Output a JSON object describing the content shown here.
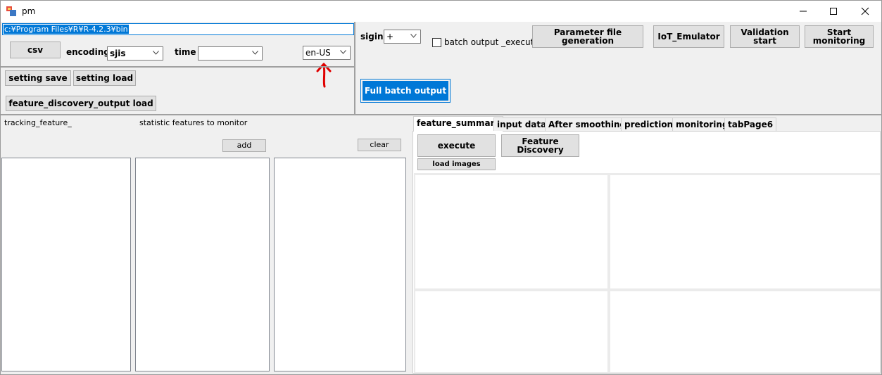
{
  "window": {
    "title": "pm"
  },
  "path_input": {
    "value": "c:¥Program Files¥R¥R-4.2.3¥bin"
  },
  "toolbar": {
    "csv_label": "csv",
    "encoding_label": "encoding",
    "encoding_value": "sjis",
    "time_label": "time",
    "time_value": "",
    "locale_value": "en-US",
    "setting_save_label": "setting save",
    "setting_load_label": "setting load",
    "feature_discovery_output_load_label": "feature_discovery_output load"
  },
  "right_top": {
    "sigin_label": "sigin",
    "sigin_value": "+",
    "batch_output_execute_label": "batch output _execute",
    "parameter_file_generation_label": "Parameter file generation",
    "iot_emulator_label": "IoT_Emulator",
    "validation_start_label": "Validation start",
    "start_monitoring_label": "Start monitoring",
    "full_batch_output_label": "Full batch output"
  },
  "left_panel": {
    "tracking_feature_label": "tracking_feature_",
    "statistic_features_label": "statistic features to monitor",
    "add_label": "add",
    "clear_label": "clear"
  },
  "tabs": [
    {
      "label": "feature_summary",
      "active": true
    },
    {
      "label": "input data"
    },
    {
      "label": "After smoothing"
    },
    {
      "label": "prediction"
    },
    {
      "label": "monitoring"
    },
    {
      "label": "tabPage6"
    }
  ],
  "feature_summary": {
    "execute_label": "execute",
    "feature_discovery_label": "Feature Discovery",
    "load_images_label": "load images"
  },
  "colors": {
    "accent": "#0078d7",
    "annotation_arrow": "#e00000"
  }
}
